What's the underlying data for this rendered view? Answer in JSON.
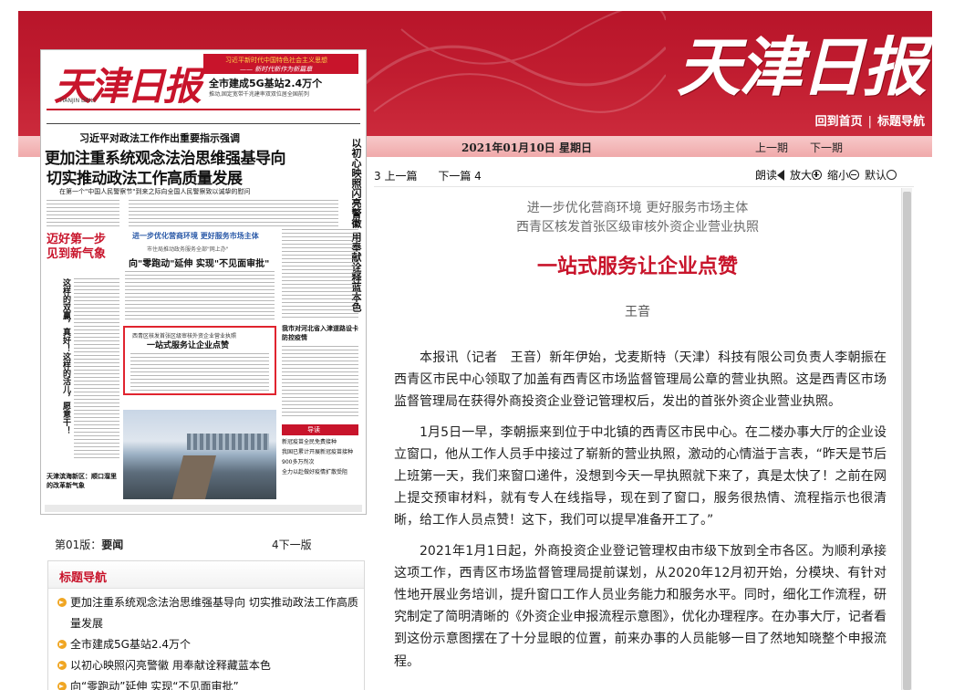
{
  "header": {
    "masthead": "天津日报",
    "nav": [
      "回到首页",
      "标题导航"
    ],
    "nav_separator": "|",
    "date": "2021年01月10日 星期日",
    "prev_issue": "上一期",
    "next_issue": "下一期",
    "colors": {
      "primary_red": "#c11d30",
      "date_bar": "#f2b5b6"
    }
  },
  "newspaper_page": {
    "masthead": "天津日报",
    "masthead_en": "TIANJIN DAILY",
    "banner_line1": "习近平新时代中国特色社会主义思想",
    "banner_line2": "—— 新时代新作为新篇章",
    "item_5g": "全市建成5G基站2.4万个",
    "item_5g_sub": "推动,固定宽带千兆建率双双位居全国前列",
    "kicker": "习近平对政法工作作出重要指示强调",
    "headline_1": "更加注重系统观念法治思维强基导向",
    "headline_2": "切实推动政法工作高质量发展",
    "deck": "在第一个\"中国人民警察节\"到来之际向全国人民警察致以诚挚的慰问",
    "side_vertical": "以初心映照闪亮警徽 用奉献诠释蓝本色",
    "red_box_1": "迈好第一步",
    "red_box_2": "见到新气象",
    "left_vertical": "这样的双赢，真好！这样的活儿，愿意干！",
    "blue_head": "进一步优化营商环境 更好服务市场主体",
    "run_sub": "市住局推动政务服务全部\"网上办\"",
    "run_head": "向\"零跑动\"延伸 实现\"不见面审批\"",
    "hl_small": "西青区核发首张区级审核外资企业营业执照",
    "hl_title": "一站式服务让企业点赞",
    "right_head": "我市对河北省入津道路设卡防控疫情",
    "guide_label": "导读",
    "guide_items": [
      "新冠疫苗全民免费接种",
      "我国已累计开展新冠疫苗接种900多万剂次",
      "全力以赴做好疫情扩散受阻"
    ],
    "left_bottom": "天津滨海新区：顺口溜里的改革新气象"
  },
  "page_label": {
    "prefix": "第01版：",
    "name": "要闻",
    "next": "4下一版"
  },
  "topic_nav": {
    "title": "标题导航",
    "items": [
      "更加注重系统观念法治思维强基导向 切实推动政法工作高质量发展",
      "全市建成5G基站2.4万个",
      "以初心映照闪亮警徽 用奉献诠释藏蓝本色",
      "向“零跑动”延伸 实现“不见面审批”"
    ]
  },
  "article_nav": {
    "prev": "3 上一篇",
    "next": "下一篇 4"
  },
  "tools": {
    "read": "朗读",
    "zoom_in": "放大",
    "zoom_out": "缩小",
    "default": "默认"
  },
  "article": {
    "pre_title_1": "进一步优化营商环境 更好服务市场主体",
    "pre_title_2": "西青区核发首张区级审核外资企业营业执照",
    "headline": "一站式服务让企业点赞",
    "author": "王音",
    "paragraphs": [
      "本报讯（记者　王音）新年伊始，戈麦斯特（天津）科技有限公司负责人李朝振在西青区市民中心领取了加盖有西青区市场监督管理局公章的营业执照。这是西青区市场监督管理局在获得外商投资企业登记管理权后，发出的首张外资企业营业执照。",
      "1月5日一早，李朝振来到位于中北镇的西青区市民中心。在二楼办事大厅的企业设立窗口，他从工作人员手中接过了崭新的营业执照，激动的心情溢于言表，“昨天是节后上班第一天，我们来窗口递件，没想到今天一早执照就下来了，真是太快了！之前在网上提交预审材料，就有专人在线指导，现在到了窗口，服务很热情、流程指示也很清晰，给工作人员点赞！这下，我们可以提早准备开工了。”",
      "2021年1月1日起，外商投资企业登记管理权由市级下放到全市各区。为顺利承接这项工作，西青区市场监督管理局提前谋划，从2020年12月初开始，分模块、有针对性地开展业务培训，提升窗口工作人员业务能力和服务水平。同时，细化工作流程，研究制定了简明清晰的《外资企业申报流程示意图》，优化办理程序。在办事大厅，记者看到这份示意图摆在了十分显眼的位置，前来办事的人员能够一目了然地知晓整个申报流程。"
    ]
  }
}
